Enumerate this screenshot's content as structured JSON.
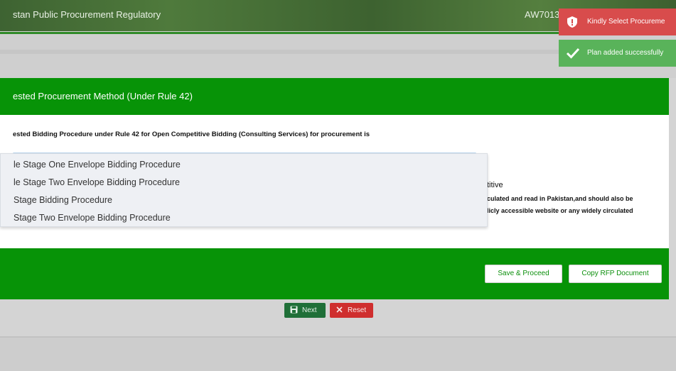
{
  "header": {
    "title": "stan Public Procurement Regulatory",
    "code": "AW7013"
  },
  "modal": {
    "title": "ested Procurement Method (Under Rule 42)",
    "question": "ested Bidding Procedure under Rule 42 for Open Competitive Bidding (Consulting Services) for procurement is",
    "dropdown_options": [
      "le Stage One Envelope Bidding Procedure",
      "le Stage Two Envelope Bidding Procedure",
      " Stage Bidding Procedure",
      " Stage Two Envelope Bidding Procedure"
    ],
    "right_text": {
      "heading": "titive",
      "line1": "culated and read in Pakistan,and should also be",
      "line2": "licly accessible website or any widely circulated"
    },
    "footer": {
      "save_label": "Save & Proceed",
      "copy_label": "Copy RFP Document"
    }
  },
  "actions": {
    "next_label": "Next",
    "reset_label": "Reset"
  },
  "toasts": {
    "error": "Kindly Select Procureme",
    "success": "Plan added successfully"
  },
  "colors": {
    "primary_green": "#079307",
    "error_red": "#d84c4c",
    "success_green": "#59b35a"
  }
}
